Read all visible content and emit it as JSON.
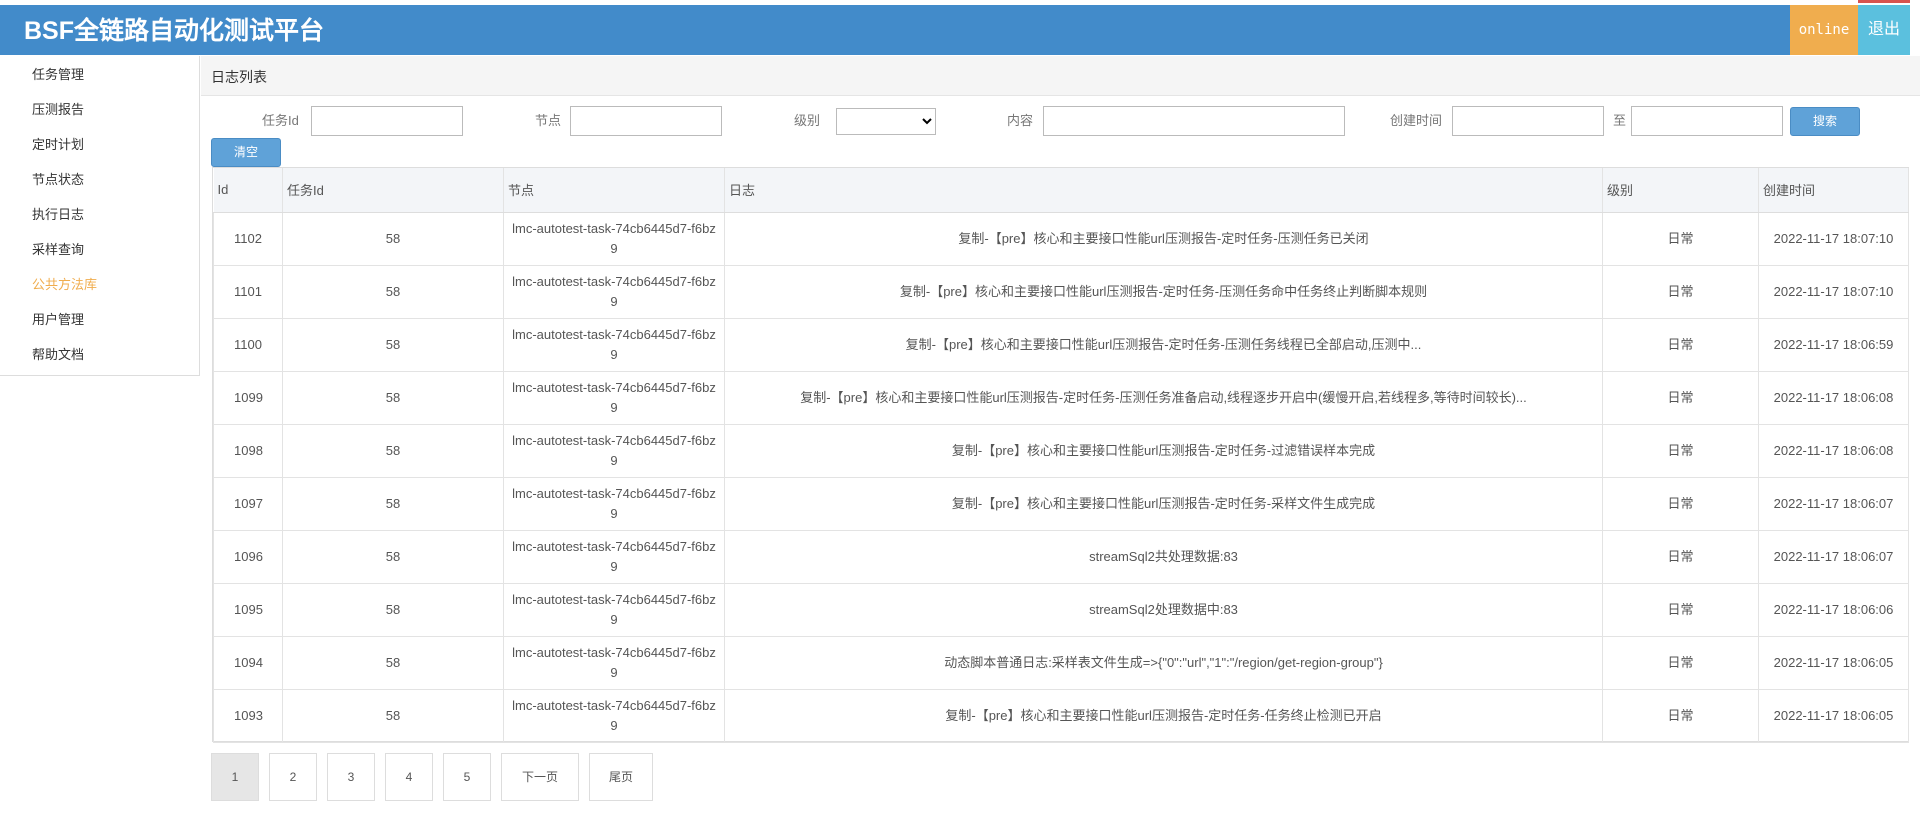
{
  "header": {
    "title": "BSF全链路自动化测试平台",
    "status": "online",
    "logout_label": "退出"
  },
  "sidebar": {
    "items": [
      {
        "label": "任务管理",
        "active": false
      },
      {
        "label": "压测报告",
        "active": false
      },
      {
        "label": "定时计划",
        "active": false
      },
      {
        "label": "节点状态",
        "active": false
      },
      {
        "label": "执行日志",
        "active": false
      },
      {
        "label": "采样查询",
        "active": false
      },
      {
        "label": "公共方法库",
        "active": true
      },
      {
        "label": "用户管理",
        "active": false
      },
      {
        "label": "帮助文档",
        "active": false
      }
    ]
  },
  "main": {
    "title": "日志列表",
    "filters": {
      "task_id_label": "任务Id",
      "task_id_value": "",
      "node_label": "节点",
      "node_value": "",
      "level_label": "级别",
      "level_value": "",
      "content_label": "内容",
      "content_value": "",
      "created_label": "创建时间",
      "created_from": "",
      "to_label": "至",
      "created_to": "",
      "search_label": "搜索",
      "clear_label": "清空"
    },
    "table": {
      "headers": [
        "Id",
        "任务Id",
        "节点",
        "日志",
        "级别",
        "创建时间"
      ],
      "rows": [
        {
          "id": "1102",
          "task_id": "58",
          "node": "lmc-autotest-task-74cb6445d7-f6bz9",
          "log": "复制-【pre】核心和主要接口性能url压测报告-定时任务-压测任务已关闭",
          "level": "日常",
          "created": "2022-11-17 18:07:10"
        },
        {
          "id": "1101",
          "task_id": "58",
          "node": "lmc-autotest-task-74cb6445d7-f6bz9",
          "log": "复制-【pre】核心和主要接口性能url压测报告-定时任务-压测任务命中任务终止判断脚本规则",
          "level": "日常",
          "created": "2022-11-17 18:07:10"
        },
        {
          "id": "1100",
          "task_id": "58",
          "node": "lmc-autotest-task-74cb6445d7-f6bz9",
          "log": "复制-【pre】核心和主要接口性能url压测报告-定时任务-压测任务线程已全部启动,压测中...",
          "level": "日常",
          "created": "2022-11-17 18:06:59"
        },
        {
          "id": "1099",
          "task_id": "58",
          "node": "lmc-autotest-task-74cb6445d7-f6bz9",
          "log": "复制-【pre】核心和主要接口性能url压测报告-定时任务-压测任务准备启动,线程逐步开启中(缓慢开启,若线程多,等待时间较长)...",
          "level": "日常",
          "created": "2022-11-17 18:06:08"
        },
        {
          "id": "1098",
          "task_id": "58",
          "node": "lmc-autotest-task-74cb6445d7-f6bz9",
          "log": "复制-【pre】核心和主要接口性能url压测报告-定时任务-过滤错误样本完成",
          "level": "日常",
          "created": "2022-11-17 18:06:08"
        },
        {
          "id": "1097",
          "task_id": "58",
          "node": "lmc-autotest-task-74cb6445d7-f6bz9",
          "log": "复制-【pre】核心和主要接口性能url压测报告-定时任务-采样文件生成完成",
          "level": "日常",
          "created": "2022-11-17 18:06:07"
        },
        {
          "id": "1096",
          "task_id": "58",
          "node": "lmc-autotest-task-74cb6445d7-f6bz9",
          "log": "streamSql2共处理数据:83",
          "level": "日常",
          "created": "2022-11-17 18:06:07"
        },
        {
          "id": "1095",
          "task_id": "58",
          "node": "lmc-autotest-task-74cb6445d7-f6bz9",
          "log": "streamSql2处理数据中:83",
          "level": "日常",
          "created": "2022-11-17 18:06:06"
        },
        {
          "id": "1094",
          "task_id": "58",
          "node": "lmc-autotest-task-74cb6445d7-f6bz9",
          "log": "动态脚本普通日志:采样表文件生成=>{\"0\":\"url\",\"1\":\"/region/get-region-group\"}",
          "level": "日常",
          "created": "2022-11-17 18:06:05"
        },
        {
          "id": "1093",
          "task_id": "58",
          "node": "lmc-autotest-task-74cb6445d7-f6bz9",
          "log": "复制-【pre】核心和主要接口性能url压测报告-定时任务-任务终止检测已开启",
          "level": "日常",
          "created": "2022-11-17 18:06:05"
        }
      ]
    },
    "pagination": {
      "pages": [
        "1",
        "2",
        "3",
        "4",
        "5"
      ],
      "current": "1",
      "next_label": "下一页",
      "last_label": "尾页"
    }
  },
  "colors": {
    "header_bg": "#428bca",
    "online_bg": "#f0ad4e",
    "logout_bg": "#5bc0de",
    "active_nav": "#f0ad4e",
    "button": "#5fa2d8"
  }
}
